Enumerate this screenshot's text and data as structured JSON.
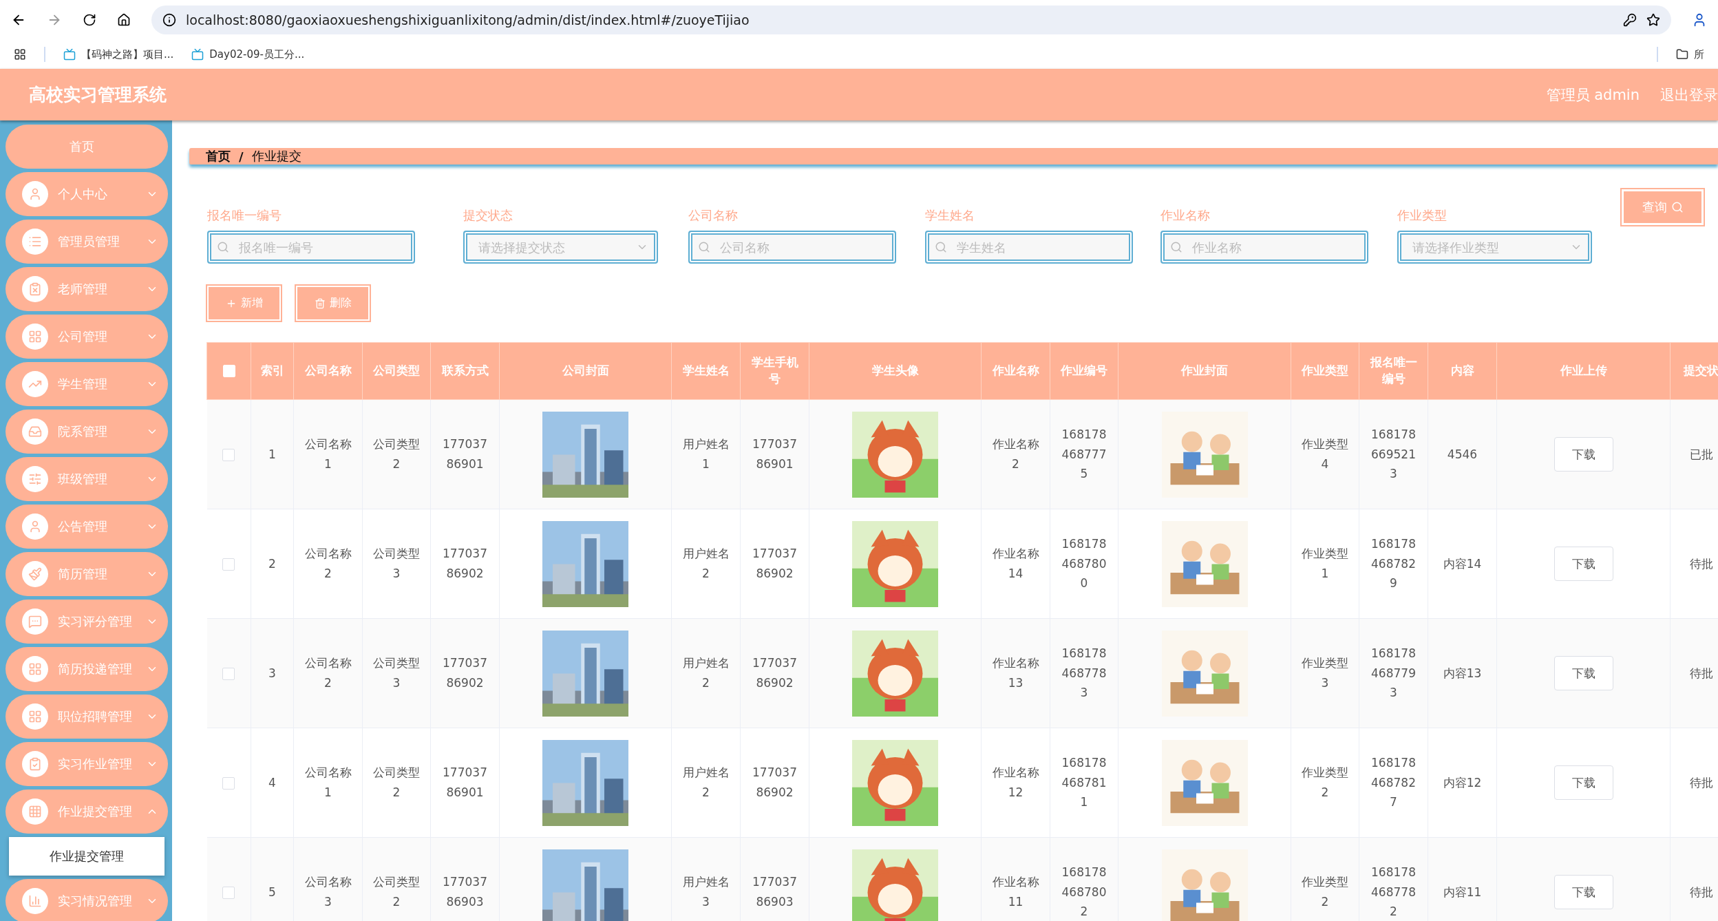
{
  "browser": {
    "url": "localhost:8080/gaoxiaoxueshengshixiguanlixitong/admin/dist/index.html#/zuoyeTijiao",
    "bookmarks": [
      "【码神之路】项目...",
      "Day02-09-员工分..."
    ],
    "folder": "所"
  },
  "header": {
    "title": "高校实习管理系统",
    "user": "管理员 admin",
    "logout": "退出登录"
  },
  "sidebar": {
    "items": [
      {
        "label": "首页"
      },
      {
        "label": "个人中心",
        "expanded": false
      },
      {
        "label": "管理员管理",
        "expanded": false
      },
      {
        "label": "老师管理",
        "expanded": false
      },
      {
        "label": "公司管理",
        "expanded": false
      },
      {
        "label": "学生管理",
        "expanded": false
      },
      {
        "label": "院系管理",
        "expanded": false
      },
      {
        "label": "班级管理",
        "expanded": false
      },
      {
        "label": "公告管理",
        "expanded": false
      },
      {
        "label": "简历管理",
        "expanded": false
      },
      {
        "label": "实习评分管理",
        "expanded": false
      },
      {
        "label": "简历投递管理",
        "expanded": false
      },
      {
        "label": "职位招聘管理",
        "expanded": false
      },
      {
        "label": "实习作业管理",
        "expanded": false
      },
      {
        "label": "作业提交管理",
        "expanded": true,
        "children": [
          {
            "label": "作业提交管理",
            "selected": true
          }
        ]
      },
      {
        "label": "实习情况管理",
        "expanded": false
      }
    ]
  },
  "breadcrumb": {
    "items": [
      "首页",
      "作业提交"
    ],
    "separator": "/"
  },
  "filters": [
    {
      "kind": "input",
      "label": "报名唯一编号",
      "placeholder": "报名唯一编号"
    },
    {
      "kind": "select",
      "label": "提交状态",
      "placeholder": "请选择提交状态"
    },
    {
      "kind": "input",
      "label": "公司名称",
      "placeholder": "公司名称"
    },
    {
      "kind": "input",
      "label": "学生姓名",
      "placeholder": "学生姓名"
    },
    {
      "kind": "input",
      "label": "作业名称",
      "placeholder": "作业名称"
    },
    {
      "kind": "select",
      "label": "作业类型",
      "placeholder": "请选择作业类型"
    }
  ],
  "query_button": "查询",
  "actions": [
    "新增",
    "删除"
  ],
  "table": {
    "all_checked": false,
    "columns": [
      "索引",
      "公司名称",
      "公司类型",
      "联系方式",
      "公司封面",
      "学生姓名",
      "学生手机号",
      "学生头像",
      "作业名称",
      "作业编号",
      "作业封面",
      "作业类型",
      "报名唯一编号",
      "内容",
      "作业上传",
      "提交状"
    ],
    "rows": [
      {
        "checked": false,
        "cells": [
          "1",
          "公司名称1",
          "公司类型2",
          "17703786901",
          {
            "kind": "picture"
          },
          "用户姓名1",
          "17703786901",
          {
            "kind": "picture"
          },
          "作业名称2",
          "1681784687775",
          {
            "kind": "picture"
          },
          "作业类型4",
          "1681786695213",
          "4546",
          {
            "kind": "button",
            "label": "下载"
          },
          "已批"
        ]
      },
      {
        "checked": false,
        "cells": [
          "2",
          "公司名称2",
          "公司类型3",
          "17703786902",
          {
            "kind": "picture"
          },
          "用户姓名2",
          "17703786902",
          {
            "kind": "picture"
          },
          "作业名称14",
          "1681784687800",
          {
            "kind": "picture"
          },
          "作业类型1",
          "1681784687829",
          "内容14",
          {
            "kind": "button",
            "label": "下载"
          },
          "待批"
        ]
      },
      {
        "checked": false,
        "cells": [
          "3",
          "公司名称2",
          "公司类型3",
          "17703786902",
          {
            "kind": "picture"
          },
          "用户姓名2",
          "17703786902",
          {
            "kind": "picture"
          },
          "作业名称13",
          "1681784687783",
          {
            "kind": "picture"
          },
          "作业类型3",
          "1681784687793",
          "内容13",
          {
            "kind": "button",
            "label": "下载"
          },
          "待批"
        ]
      },
      {
        "checked": false,
        "cells": [
          "4",
          "公司名称1",
          "公司类型2",
          "17703786901",
          {
            "kind": "picture"
          },
          "用户姓名2",
          "17703786902",
          {
            "kind": "picture"
          },
          "作业名称12",
          "1681784687811",
          {
            "kind": "picture"
          },
          "作业类型2",
          "1681784687827",
          "内容12",
          {
            "kind": "button",
            "label": "下载"
          },
          "待批"
        ]
      },
      {
        "checked": false,
        "cells": [
          "5",
          "公司名称3",
          "公司类型2",
          "17703786903",
          {
            "kind": "picture"
          },
          "用户姓名3",
          "17703786903",
          {
            "kind": "picture"
          },
          "作业名称11",
          "1681784687802",
          {
            "kind": "picture"
          },
          "作业类型2",
          "1681784687782",
          "内容11",
          {
            "kind": "button",
            "label": "下载"
          },
          "待批"
        ]
      }
    ]
  }
}
